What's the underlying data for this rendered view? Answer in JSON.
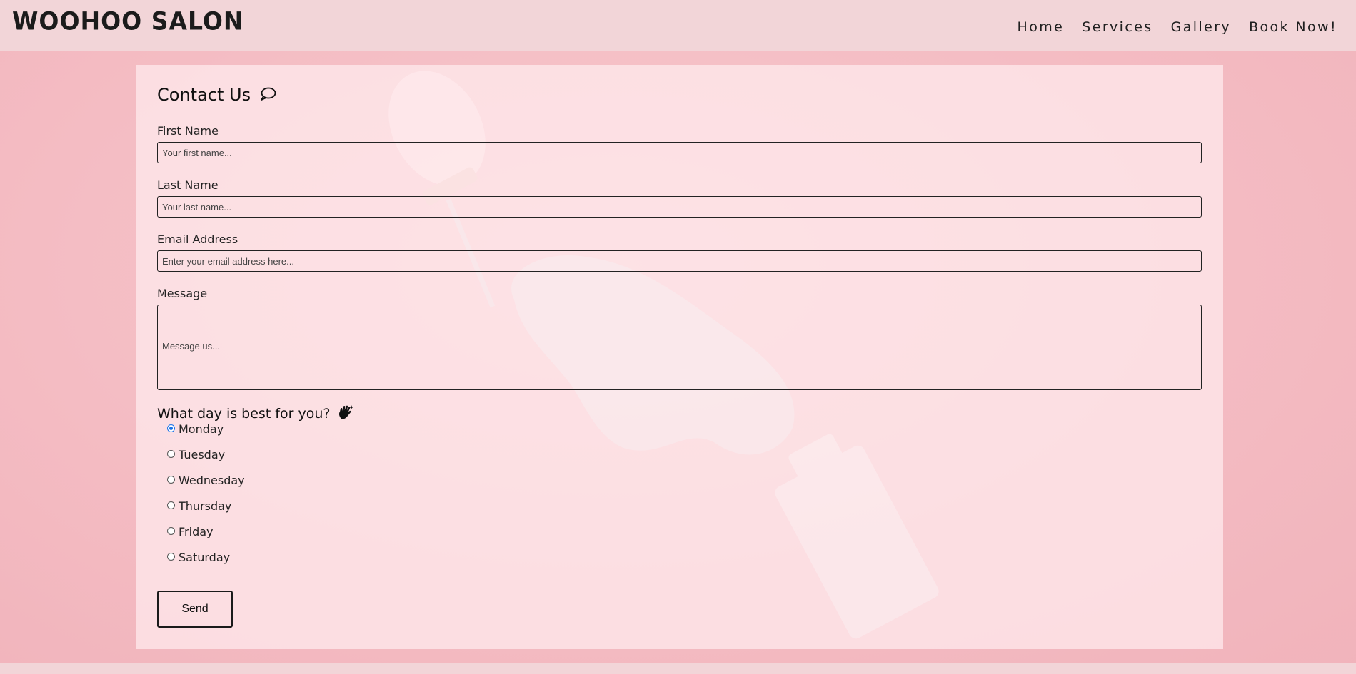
{
  "header": {
    "logo": "WOOHOO SALON",
    "nav": [
      "Home",
      "Services",
      "Gallery",
      "Book Now!"
    ]
  },
  "contact": {
    "title": "Contact Us",
    "first_name_label": "First Name",
    "first_name_placeholder": "Your first name...",
    "last_name_label": "Last Name",
    "last_name_placeholder": "Your last name...",
    "email_label": "Email Address",
    "email_placeholder": "Enter your email address here...",
    "message_label": "Message",
    "message_placeholder": "Message us...",
    "day_question": "What day is best for you?",
    "days": [
      "Monday",
      "Tuesday",
      "Wednesday",
      "Thursday",
      "Friday",
      "Saturday"
    ],
    "selected_day": "Monday",
    "send_label": "Send"
  },
  "colors": {
    "header_bg": "#f2d5d8",
    "page_bg": "#f4bcc3",
    "radio_accent": "#1a73e8"
  },
  "icons": {
    "title_icon": "speech-bubble-icon",
    "question_icon": "waving-hand-icon"
  }
}
